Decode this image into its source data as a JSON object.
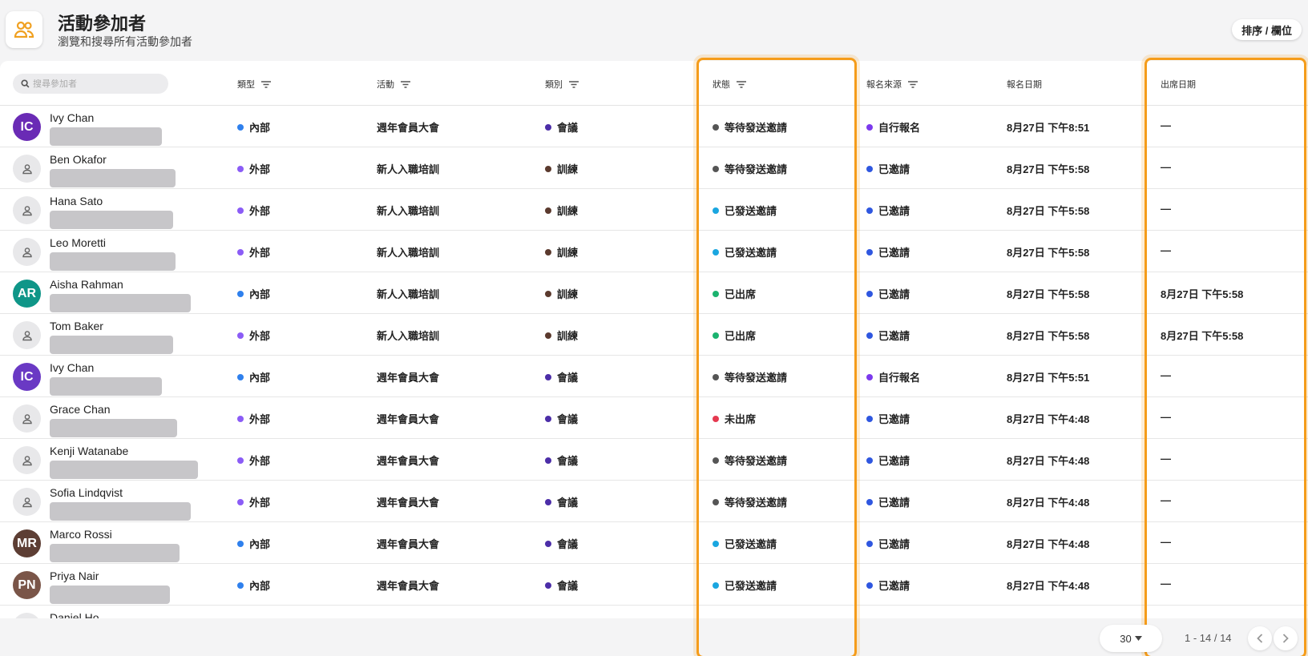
{
  "header": {
    "title": "活動參加者",
    "subtitle": "瀏覽和搜尋所有活動參加者",
    "sort_button": "排序 / 欄位"
  },
  "search": {
    "placeholder": "搜尋參加者"
  },
  "columns": {
    "type": "類型",
    "event": "活動",
    "category": "類別",
    "status": "狀態",
    "source": "報名來源",
    "reg_date": "報名日期",
    "attend_date": "出席日期"
  },
  "colors": {
    "internal": "#2f80ed",
    "external": "#8b5cf6",
    "meeting": "#4c2ea8",
    "training": "#5b3a2e",
    "pending": "#555555",
    "sent": "#1aa6e0",
    "attended": "#1bb36f",
    "absent": "#e53950",
    "self_reg": "#7c3aed",
    "invited": "#2f57e0",
    "highlight": "#f59c1a"
  },
  "rows": [
    {
      "name": "Ivy Chan",
      "initials": "IC",
      "avatar_color": "#6a2bb5",
      "type": "內部",
      "event": "週年會員大會",
      "category": "會議",
      "status": "等待發送邀請",
      "source": "自行報名",
      "reg_date": "8月27日 下午8:51",
      "attend_date": "—"
    },
    {
      "name": "Ben Okafor",
      "initials": "",
      "avatar_color": "",
      "type": "外部",
      "event": "新人入職培訓",
      "category": "訓練",
      "status": "等待發送邀請",
      "source": "已邀請",
      "reg_date": "8月27日 下午5:58",
      "attend_date": "—"
    },
    {
      "name": "Hana Sato",
      "initials": "",
      "avatar_color": "",
      "type": "外部",
      "event": "新人入職培訓",
      "category": "訓練",
      "status": "已發送邀請",
      "source": "已邀請",
      "reg_date": "8月27日 下午5:58",
      "attend_date": "—"
    },
    {
      "name": "Leo Moretti",
      "initials": "",
      "avatar_color": "",
      "type": "外部",
      "event": "新人入職培訓",
      "category": "訓練",
      "status": "已發送邀請",
      "source": "已邀請",
      "reg_date": "8月27日 下午5:58",
      "attend_date": "—"
    },
    {
      "name": "Aisha Rahman",
      "initials": "AR",
      "avatar_color": "#0f9688",
      "type": "內部",
      "event": "新人入職培訓",
      "category": "訓練",
      "status": "已出席",
      "source": "已邀請",
      "reg_date": "8月27日 下午5:58",
      "attend_date": "8月27日 下午5:58"
    },
    {
      "name": "Tom Baker",
      "initials": "",
      "avatar_color": "",
      "type": "外部",
      "event": "新人入職培訓",
      "category": "訓練",
      "status": "已出席",
      "source": "已邀請",
      "reg_date": "8月27日 下午5:58",
      "attend_date": "8月27日 下午5:58"
    },
    {
      "name": "Ivy Chan",
      "initials": "IC",
      "avatar_color": "#6a39c4",
      "type": "內部",
      "event": "週年會員大會",
      "category": "會議",
      "status": "等待發送邀請",
      "source": "自行報名",
      "reg_date": "8月27日 下午5:51",
      "attend_date": "—"
    },
    {
      "name": "Grace Chan",
      "initials": "",
      "avatar_color": "",
      "type": "外部",
      "event": "週年會員大會",
      "category": "會議",
      "status": "未出席",
      "source": "已邀請",
      "reg_date": "8月27日 下午4:48",
      "attend_date": "—"
    },
    {
      "name": "Kenji Watanabe",
      "initials": "",
      "avatar_color": "",
      "type": "外部",
      "event": "週年會員大會",
      "category": "會議",
      "status": "等待發送邀請",
      "source": "已邀請",
      "reg_date": "8月27日 下午4:48",
      "attend_date": "—"
    },
    {
      "name": "Sofia Lindqvist",
      "initials": "",
      "avatar_color": "",
      "type": "外部",
      "event": "週年會員大會",
      "category": "會議",
      "status": "等待發送邀請",
      "source": "已邀請",
      "reg_date": "8月27日 下午4:48",
      "attend_date": "—"
    },
    {
      "name": "Marco Rossi",
      "initials": "MR",
      "avatar_color": "#5d3e34",
      "type": "內部",
      "event": "週年會員大會",
      "category": "會議",
      "status": "已發送邀請",
      "source": "已邀請",
      "reg_date": "8月27日 下午4:48",
      "attend_date": "—"
    },
    {
      "name": "Priya Nair",
      "initials": "PN",
      "avatar_color": "#7a5548",
      "type": "內部",
      "event": "週年會員大會",
      "category": "會議",
      "status": "已發送邀請",
      "source": "已邀請",
      "reg_date": "8月27日 下午4:48",
      "attend_date": "—"
    },
    {
      "name": "Daniel Ho",
      "initials": "",
      "avatar_color": "",
      "type": "",
      "event": "",
      "category": "",
      "status": "",
      "source": "",
      "reg_date": "",
      "attend_date": ""
    }
  ],
  "pagination": {
    "per_page": "30",
    "range": "1 - 14 / 14"
  }
}
